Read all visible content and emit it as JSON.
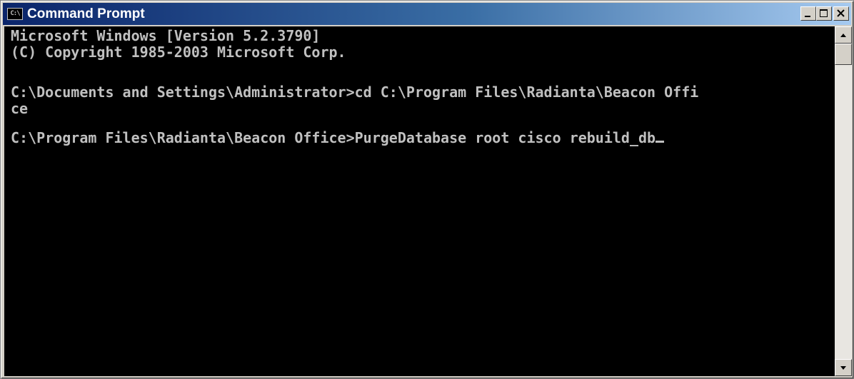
{
  "window": {
    "title": "Command Prompt",
    "icon": "cmd-icon",
    "icon_text": "C:\\",
    "controls": [
      "minimize-icon",
      "maximize-icon",
      "close-icon"
    ]
  },
  "console": {
    "lines": [
      "Microsoft Windows [Version 5.2.3790]",
      "(C) Copyright 1985-2003 Microsoft Corp.",
      "",
      "C:\\Documents and Settings\\Administrator>cd C:\\Program Files\\Radianta\\Beacon Offi",
      "ce",
      "",
      "C:\\Program Files\\Radianta\\Beacon Office>PurgeDatabase root cisco rebuild_db"
    ],
    "text_color": "#c0c0c0",
    "background": "#000000"
  },
  "colors": {
    "titlebar_start": "#0a246a",
    "titlebar_end": "#a6caf0",
    "chrome": "#d4d0c8"
  }
}
